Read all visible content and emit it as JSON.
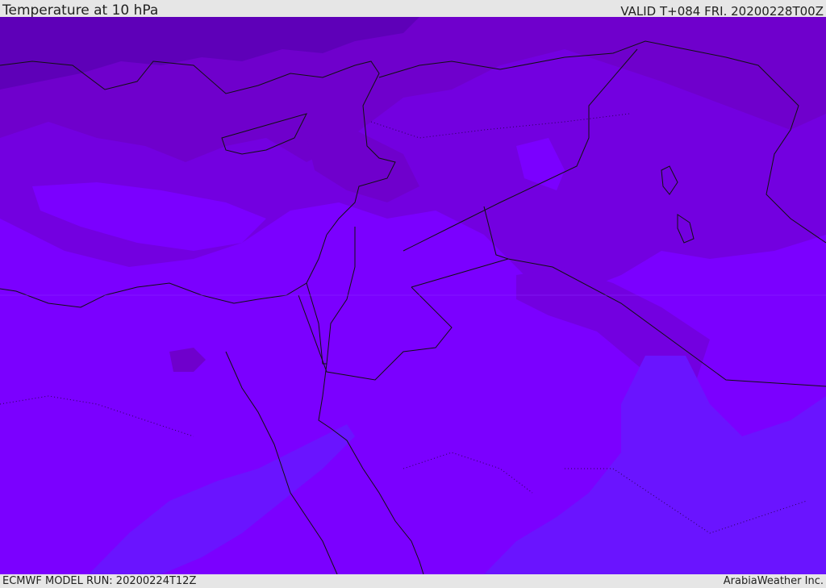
{
  "header": {
    "title": "Temperature at 10 hPa",
    "valid": "VALID T+084 FRI. 20200228T00Z"
  },
  "footer": {
    "model_run": "ECMWF MODEL RUN: 20200224T12Z",
    "credit": "ArabiaWeather Inc."
  },
  "map": {
    "colors": {
      "coldest": "#5e00b8",
      "cold": "#6f00cc",
      "mid": "#7300e0",
      "base": "#7b00ff",
      "warm": "#6a14ff",
      "coast": "#111111"
    }
  }
}
